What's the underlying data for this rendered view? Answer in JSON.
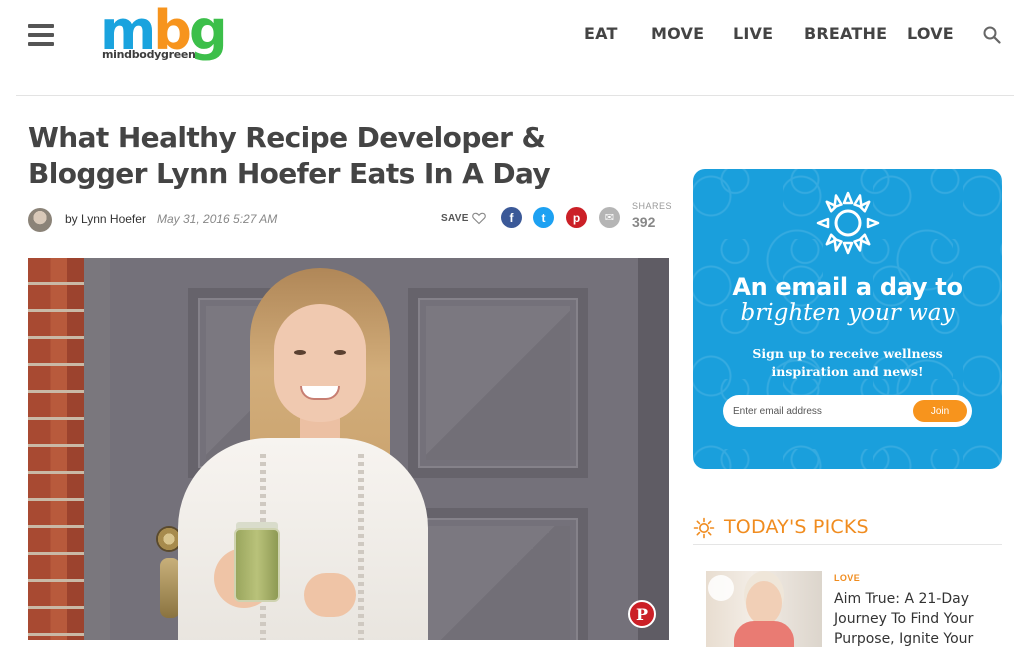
{
  "header": {
    "logo_text": "mbg",
    "logo_subtext": "mindbodygreen",
    "nav": [
      "EAT",
      "MOVE",
      "LIVE",
      "BREATHE",
      "LOVE"
    ]
  },
  "article": {
    "title": "What Healthy Recipe Developer & Blogger Lynn Hoefer Eats In A Day",
    "author": "by Lynn Hoefer",
    "date": "May 31, 2016 5:27 AM",
    "save_label": "SAVE",
    "shares_label": "SHARES",
    "shares_count": "392",
    "share_buttons": [
      {
        "name": "facebook",
        "glyph": "f",
        "color": "#3b5998"
      },
      {
        "name": "twitter",
        "glyph": "t",
        "color": "#1da1f2"
      },
      {
        "name": "pinterest",
        "glyph": "p",
        "color": "#cb2027"
      },
      {
        "name": "email",
        "glyph": "✉",
        "color": "#b5b5b5"
      }
    ],
    "pin_glyph": "P"
  },
  "newsletter": {
    "headline": "An email a day to",
    "subhead": "brighten your way",
    "copy": "Sign up to receive wellness inspiration and news!",
    "input_placeholder": "Enter email address",
    "button_label": "Join",
    "background_color": "#1a9fdc",
    "button_color": "#f7941d"
  },
  "picks": {
    "title": "TODAY'S PICKS",
    "accent_color": "#f08c1f",
    "items": [
      {
        "category": "LOVE",
        "title": "Aim True: A 21-Day Journey To Find Your Purpose, Ignite Your"
      }
    ]
  }
}
